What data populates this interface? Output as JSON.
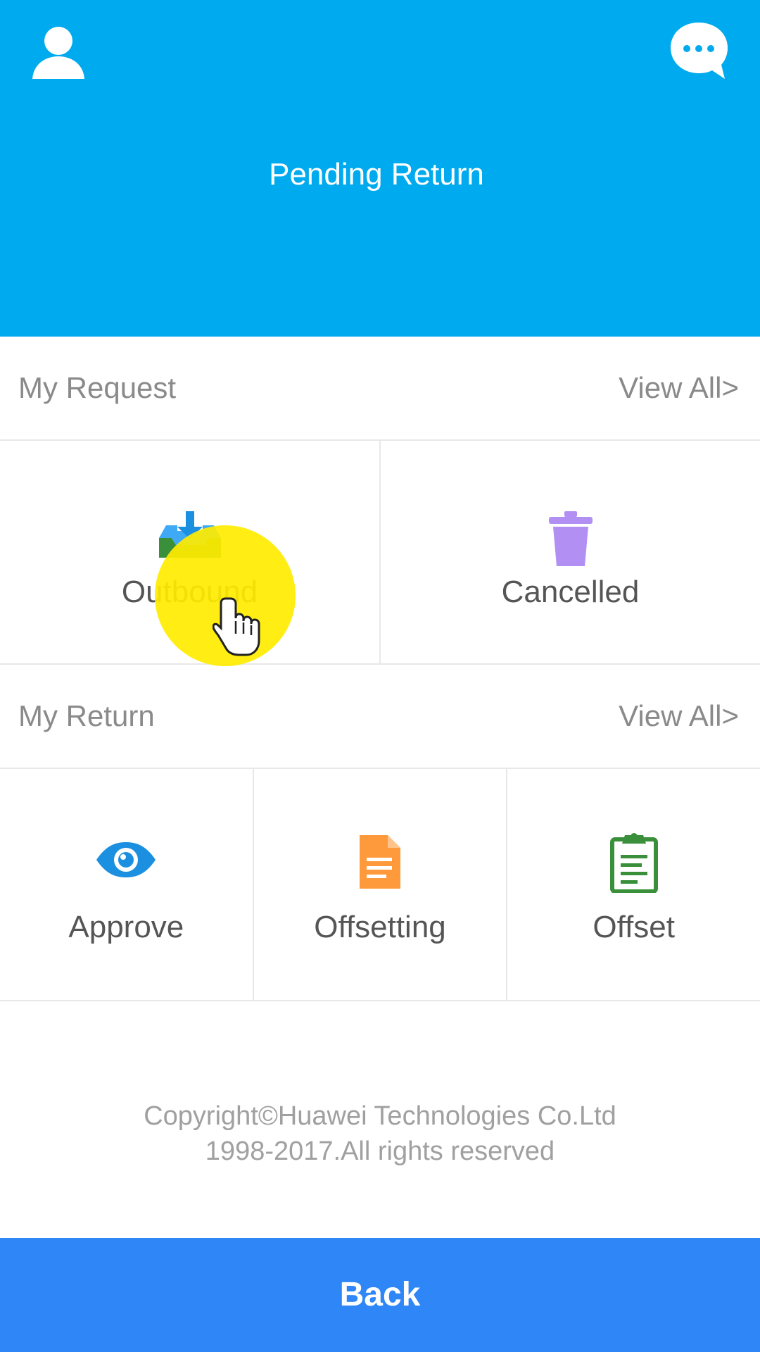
{
  "header": {
    "title": "Pending Return",
    "left_icon": "user-profile-icon",
    "right_icon": "chat-bubble-icon",
    "background": "#00aaee"
  },
  "my_request": {
    "label": "My Request",
    "view_all": "View All>",
    "tiles": [
      {
        "label": "Outbound",
        "icon": "download-tray-icon"
      },
      {
        "label": "Cancelled",
        "icon": "trash-icon"
      }
    ]
  },
  "my_return": {
    "label": "My Return",
    "view_all": "View All>",
    "tiles": [
      {
        "label": "Approve",
        "icon": "eye-icon"
      },
      {
        "label": "Offsetting",
        "icon": "document-icon"
      },
      {
        "label": "Offset",
        "icon": "clipboard-icon"
      }
    ]
  },
  "footer": {
    "copyright_line1": "Copyright©Huawei Technologies Co.Ltd",
    "copyright_line2": "1998-2017.All rights reserved"
  },
  "back_button": {
    "label": "Back",
    "background": "#2f86f6"
  },
  "colors": {
    "icon_blue": "#1b8fe0",
    "icon_green": "#3a8f3a",
    "icon_purple": "#b28ff2",
    "icon_orange": "#ff9a3c",
    "highlight_yellow": "#ffec00"
  }
}
